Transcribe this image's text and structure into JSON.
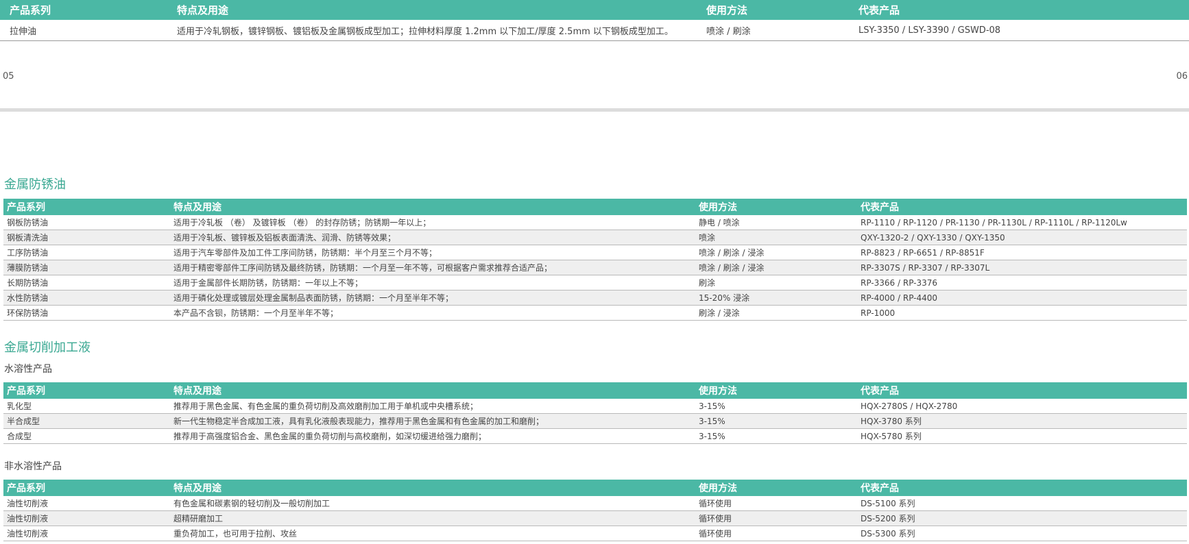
{
  "headers": {
    "series": "产品系列",
    "features": "特点及用途",
    "method": "使用方法",
    "products": "代表产品"
  },
  "top_table": {
    "rows": [
      {
        "series": "拉伸油",
        "features": "适用于冷轧钢板，镀锌钢板、镀铝板及金属钢板成型加工；拉伸材料厚度 1.2mm 以下加工/厚度 2.5mm 以下钢板成型加工。",
        "method": "喷涂 / 刷涂",
        "products": "LSY-3350 / LSY-3390 / GSWD-08"
      }
    ]
  },
  "page_numbers": {
    "left": "05",
    "right": "06"
  },
  "rust": {
    "title": "金属防锈油",
    "rows": [
      {
        "series": "钢板防锈油",
        "features": "适用于冷轧板 （卷） 及镀锌板 （卷） 的封存防锈；防锈期一年以上；",
        "method": "静电 / 喷涂",
        "products": "RP-1110 / RP-1120 / PR-1130 / PR-1130L / RP-1110L / RP-1120Lw"
      },
      {
        "series": "钢板清洗油",
        "features": "适用于冷轧板、镀锌板及铝板表面清洗、润滑、防锈等效果；",
        "method": "喷涂",
        "products": "QXY-1320-2 / QXY-1330 / QXY-1350"
      },
      {
        "series": "工序防锈油",
        "features": "适用于汽车零部件及加工件工序间防锈，防锈期：半个月至三个月不等；",
        "method": "喷涂 / 刷涂 / 浸涂",
        "products": "RP-8823 / RP-6651 / RP-8851F"
      },
      {
        "series": "薄膜防锈油",
        "features": "适用于精密零部件工序间防锈及最终防锈，防锈期：一个月至一年不等，可根据客户需求推荐合适产品；",
        "method": "喷涂 / 刷涂 / 浸涂",
        "products": "RP-3307S / RP-3307 / RP-3307L"
      },
      {
        "series": "长期防锈油",
        "features": "适用于金属部件长期防锈，防锈期：一年以上不等；",
        "method": "刷涂",
        "products": "RP-3366 / RP-3376"
      },
      {
        "series": "水性防锈油",
        "features": "适用于磷化处理或镀层处理金属制品表面防锈，防锈期：一个月至半年不等；",
        "method": "15-20% 浸涂",
        "products": "RP-4000 / RP-4400"
      },
      {
        "series": "环保防锈油",
        "features": "本产品不含钡，防锈期：一个月至半年不等；",
        "method": "刷涂 / 浸涂",
        "products": "RP-1000"
      }
    ]
  },
  "cutting": {
    "title": "金属切削加工液",
    "water_subtitle": "水溶性产品",
    "water_rows": [
      {
        "series": "乳化型",
        "features": "推荐用于黑色金属、有色金属的重负荷切削及高效磨削加工用于单机或中央槽系统；",
        "method": "3-15%",
        "products": "HQX-2780S / HQX-2780"
      },
      {
        "series": "半合成型",
        "features": "新一代生物稳定半合成加工液，具有乳化液般表现能力，推荐用于黑色金属和有色金属的加工和磨削；",
        "method": "3-15%",
        "products": "HQX-3780 系列"
      },
      {
        "series": "合成型",
        "features": "推荐用于高强度铝合金、黑色金属的重负荷切削与高校磨削，如深切缓进给强力磨削；",
        "method": "3-15%",
        "products": "HQX-5780 系列"
      }
    ],
    "nonwater_subtitle": "非水溶性产品",
    "nonwater_rows": [
      {
        "series": "油性切削液",
        "features": "有色金属和碳素钢的轻切削及一般切削加工",
        "method": "循环使用",
        "products": "DS-5100 系列"
      },
      {
        "series": "油性切削液",
        "features": "超精研磨加工",
        "method": "循环使用",
        "products": "DS-5200 系列"
      },
      {
        "series": "油性切削液",
        "features": "重负荷加工，也可用于拉削、攻丝",
        "method": "循环使用",
        "products": "DS-5300 系列"
      }
    ]
  }
}
